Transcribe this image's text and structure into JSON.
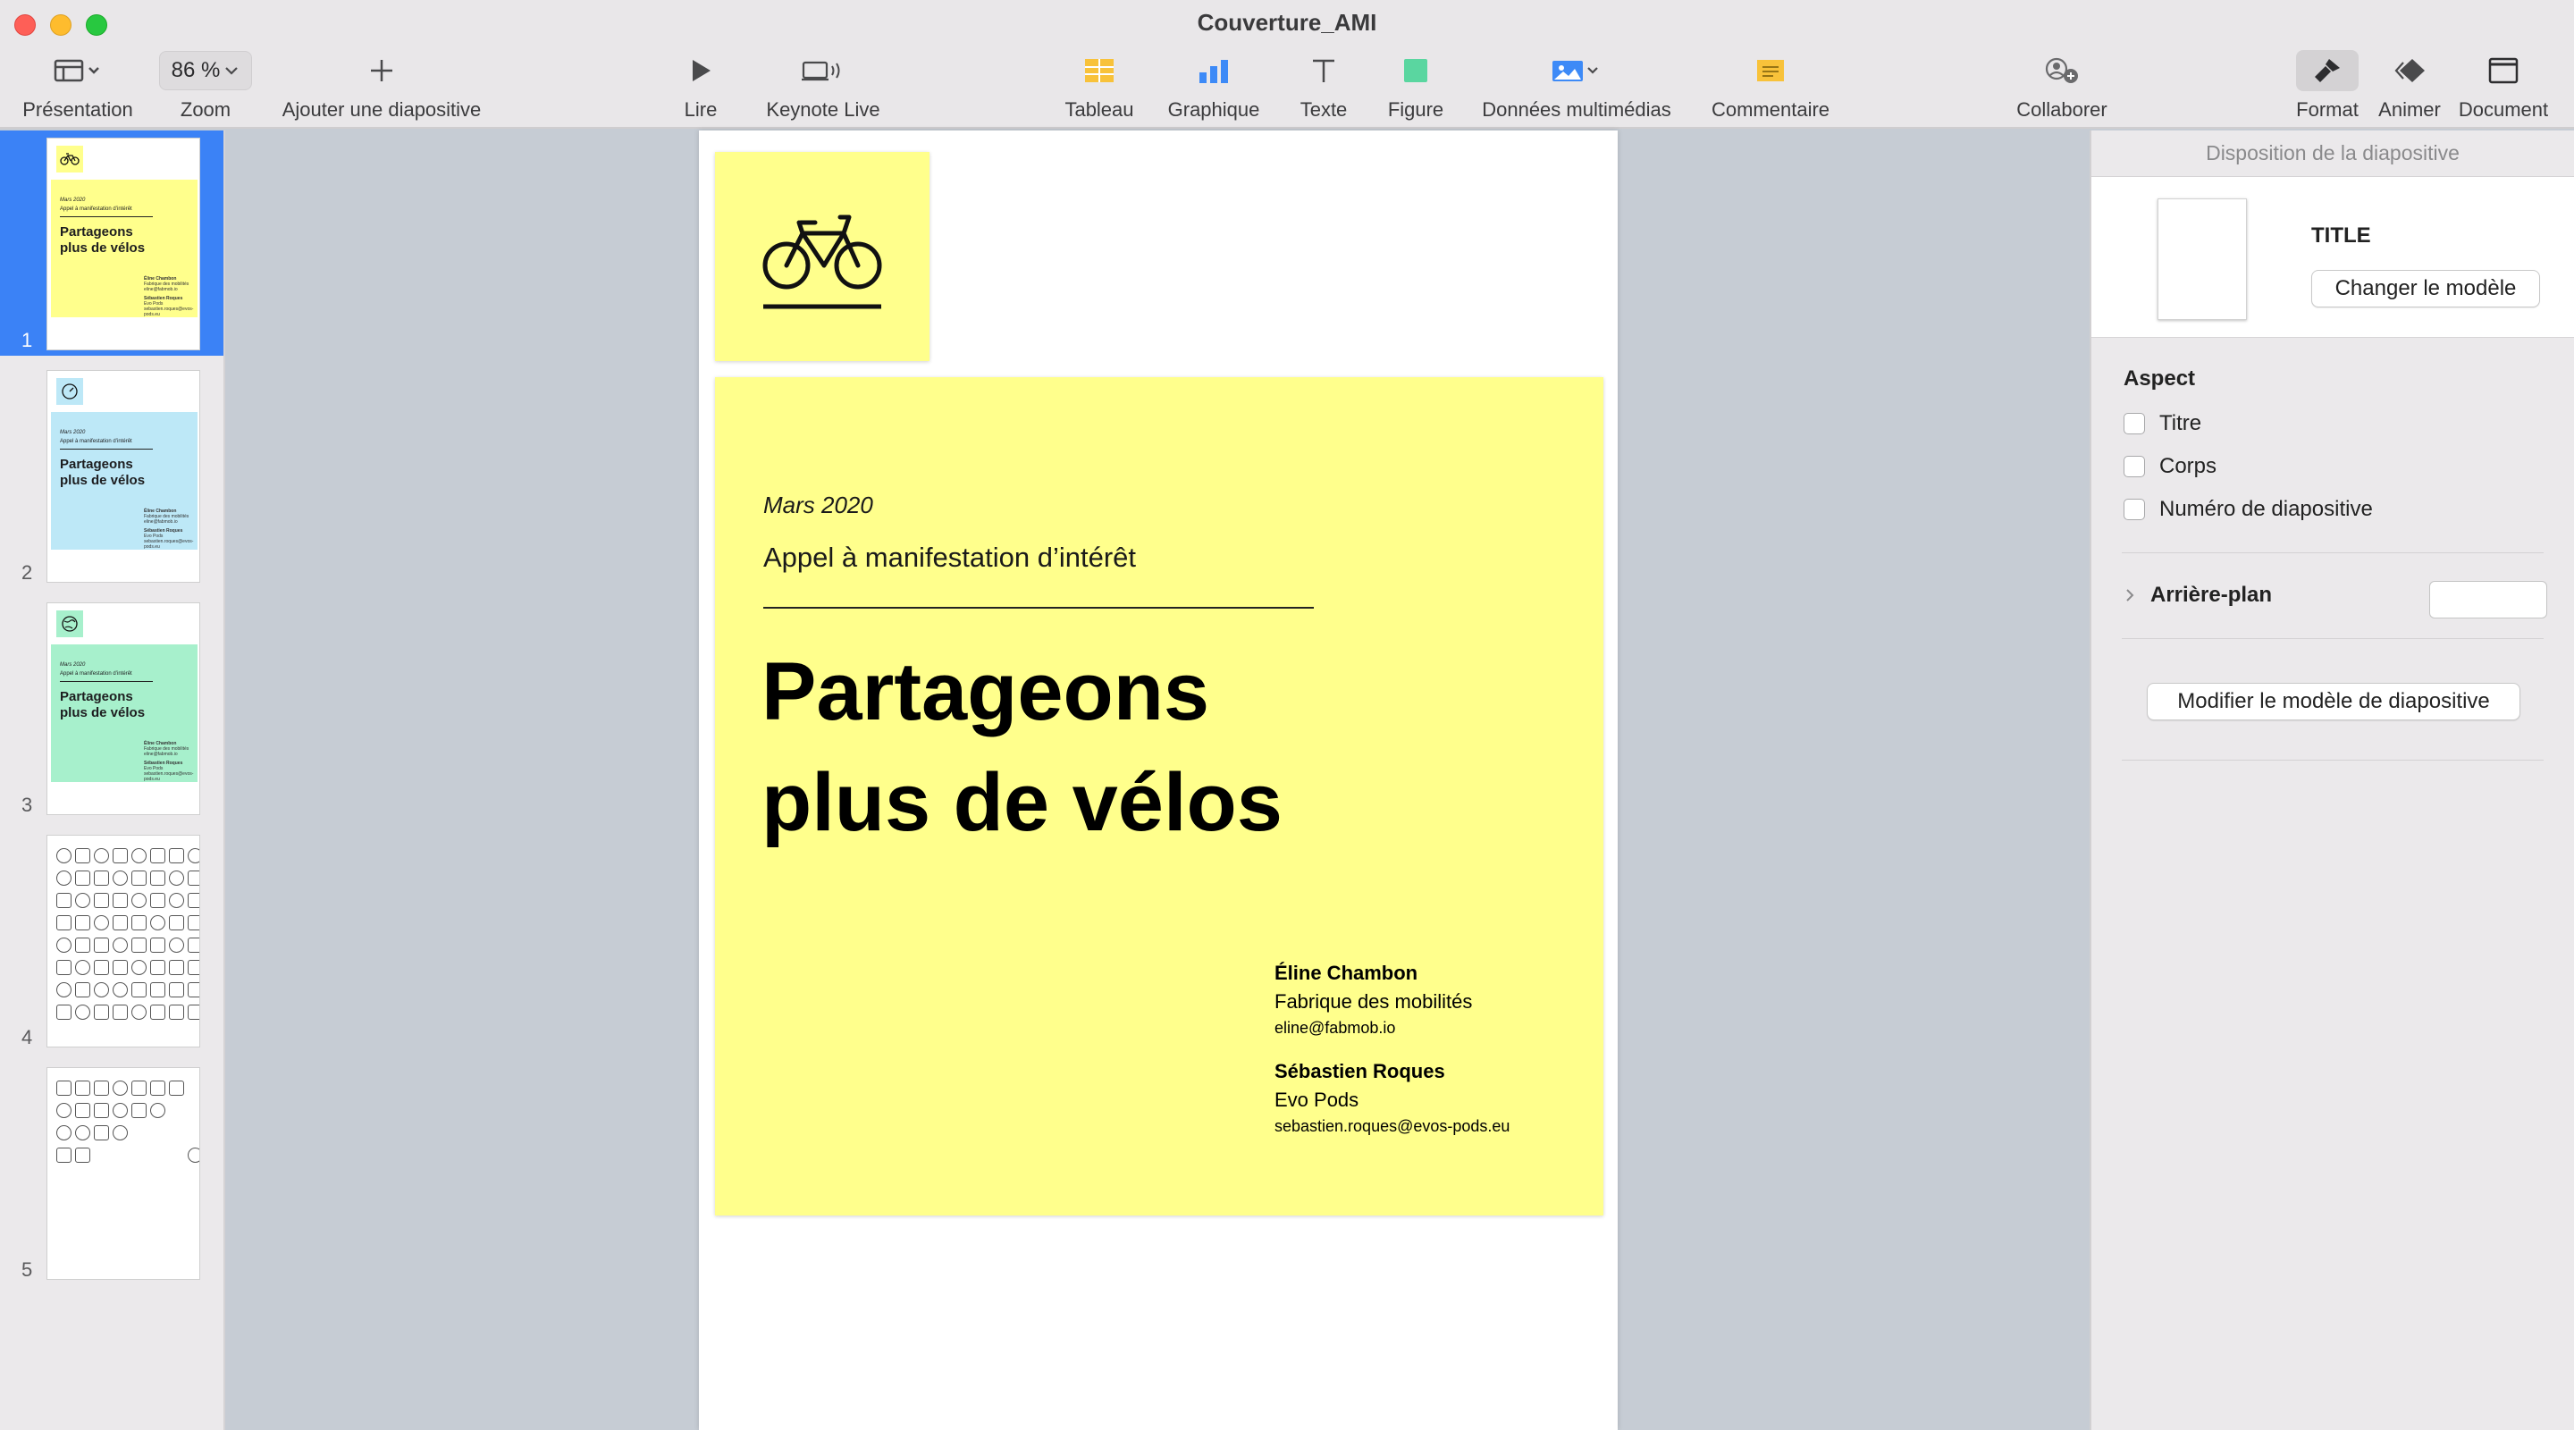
{
  "window": {
    "title": "Couverture_AMI"
  },
  "toolbar": {
    "presentation": "Présentation",
    "zoom_value": "86 %",
    "zoom": "Zoom",
    "add_slide": "Ajouter une diapositive",
    "play": "Lire",
    "keynote_live": "Keynote Live",
    "table": "Tableau",
    "chart": "Graphique",
    "text": "Texte",
    "shape": "Figure",
    "media": "Données multimédias",
    "comment": "Commentaire",
    "collaborate": "Collaborer",
    "format": "Format",
    "animate": "Animer",
    "document": "Document"
  },
  "navigator": {
    "slides": [
      {
        "number": "1",
        "accent": "#ffff8c"
      },
      {
        "number": "2",
        "accent": "#bde8f7"
      },
      {
        "number": "3",
        "accent": "#a7f0cc"
      },
      {
        "number": "4"
      },
      {
        "number": "5"
      }
    ]
  },
  "slide": {
    "date": "Mars 2020",
    "subtitle": "Appel à manifestation d’intérêt",
    "title_line1": "Partageons",
    "title_line2": "plus de vélos",
    "authors": [
      {
        "name": "Éline Chambon",
        "org": "Fabrique des mobilités",
        "email": "eline@fabmob.io"
      },
      {
        "name": "Sébastien Roques",
        "org": "Evo Pods",
        "email": "sebastien.roques@evos-pods.eu"
      }
    ],
    "accent_color": "#ffff8c"
  },
  "inspector": {
    "header": "Disposition de la diapositive",
    "layout_name": "TITLE",
    "change_template": "Changer le modèle",
    "appearance": "Aspect",
    "checkboxes": [
      "Titre",
      "Corps",
      "Numéro de diapositive"
    ],
    "background": "Arrière-plan",
    "edit_layout": "Modifier le modèle de diapositive"
  }
}
